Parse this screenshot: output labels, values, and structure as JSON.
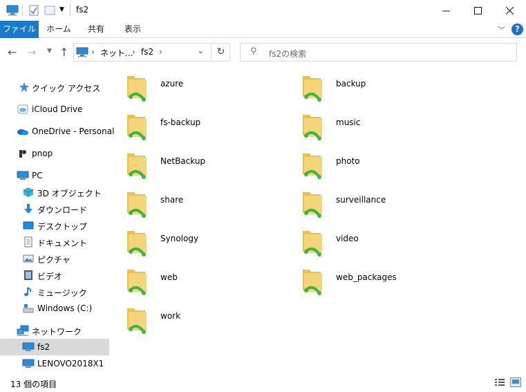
{
  "window": {
    "title": "fs2"
  },
  "ribbon": {
    "tabs": [
      "ファイル",
      "ホーム",
      "共有",
      "表示"
    ],
    "help_label": "?"
  },
  "address": {
    "crumbs": [
      "ネット...",
      "fs2"
    ]
  },
  "search": {
    "placeholder": "fs2の検索"
  },
  "sidebar": {
    "items": [
      {
        "label": "クイック アクセス",
        "icon": "star-icon"
      },
      {
        "label": "iCloud Drive",
        "icon": "icloud-icon"
      },
      {
        "label": "OneDrive - Personal",
        "icon": "onedrive-cloud-icon"
      },
      {
        "label": "pnop",
        "icon": "user-folder-icon"
      },
      {
        "label": "PC",
        "icon": "pc-icon"
      },
      {
        "label": "3D オブジェクト",
        "icon": "3d-objects-icon"
      },
      {
        "label": "ダウンロード",
        "icon": "download-arrow-icon"
      },
      {
        "label": "デスクトップ",
        "icon": "desktop-icon"
      },
      {
        "label": "ドキュメント",
        "icon": "document-icon"
      },
      {
        "label": "ピクチャ",
        "icon": "pictures-icon"
      },
      {
        "label": "ビデオ",
        "icon": "video-icon"
      },
      {
        "label": "ミュージック",
        "icon": "music-note-icon"
      },
      {
        "label": "Windows (C:)",
        "icon": "drive-icon"
      },
      {
        "label": "ネットワーク",
        "icon": "network-icon"
      },
      {
        "label": "fs2",
        "icon": "computer-icon"
      },
      {
        "label": "LENOVO2018X1",
        "icon": "computer-icon"
      }
    ]
  },
  "folders": [
    "azure",
    "backup",
    "fs-backup",
    "music",
    "NetBackup",
    "photo",
    "share",
    "surveillance",
    "Synology",
    "video",
    "web",
    "web_packages",
    "work"
  ],
  "status": {
    "count_text": "13 個の項目"
  },
  "colors": {
    "accent": "#1979ca",
    "folder": "#f3d67a",
    "share_green": "#3fb63f",
    "selected": "#d9d9d9"
  }
}
